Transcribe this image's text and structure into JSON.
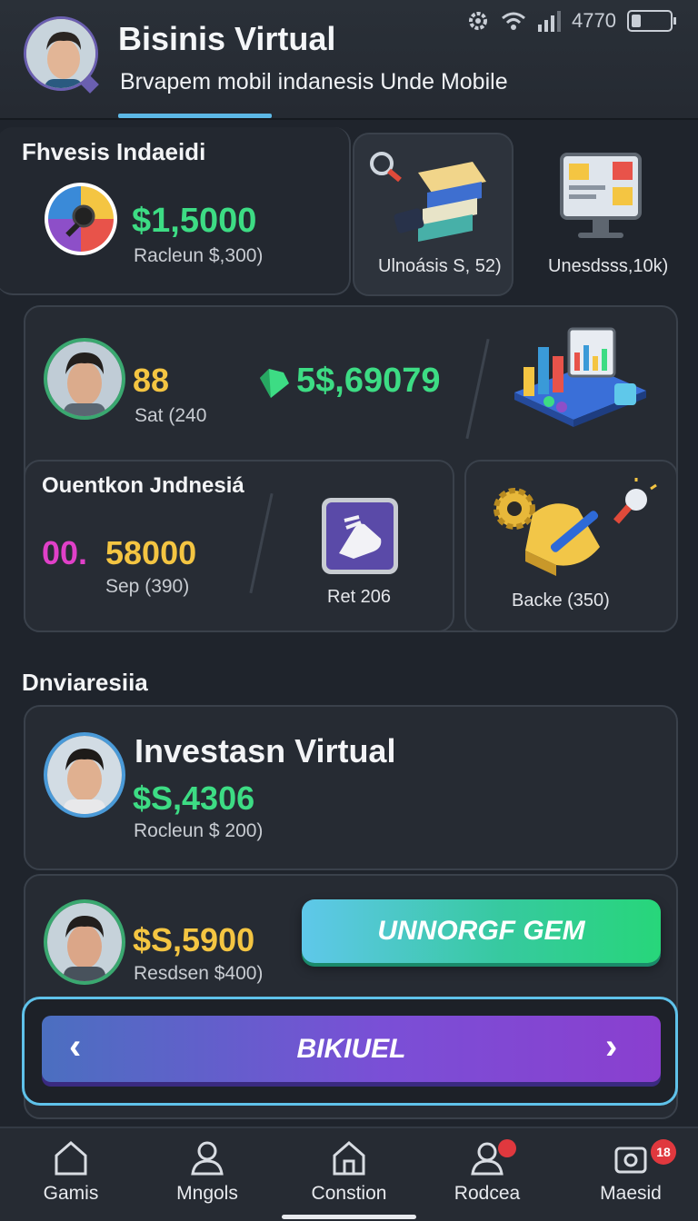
{
  "status_bar": {
    "time": "4770",
    "icons": [
      "gear-icon",
      "wifi-icon",
      "signal-icon",
      "battery-icon"
    ]
  },
  "header": {
    "title": "Bisinis Virtual",
    "subtitle": "Brvapem mobil  indanesis Unde Mobile"
  },
  "section1": {
    "heading": "Fhvesis Indaeidi",
    "main": {
      "value": "$1,5000",
      "caption": "Racleun $,300)"
    },
    "tile1": {
      "caption": "Ulnoásis S, 52)"
    },
    "tile2": {
      "caption": "Unesdsss,10k)"
    }
  },
  "stats_card": {
    "count": "88",
    "count_caption": "Sat (240",
    "gem_value": "5$,69079"
  },
  "sub_card1": {
    "title": "Ouentkon Jndnesiá",
    "prefix": "00.",
    "value": "58000",
    "caption": "Sep (390)",
    "tile_caption": "Ret 206"
  },
  "sub_card2": {
    "caption": "Backe (350)"
  },
  "section2": {
    "heading": "Dnviaresiia",
    "invest_card": {
      "title": "Investasn Virtual",
      "value": "$S,4306",
      "caption": "Rocleun $ 200)"
    },
    "card2": {
      "value": "$S,5900",
      "caption": "Resdsen $400)"
    }
  },
  "buttons": {
    "upgrade": "UNNORGF GEM",
    "nav_bar": "BIKIUEL"
  },
  "bottom_nav": {
    "items": [
      {
        "label": "Gamis",
        "icon": "home-icon"
      },
      {
        "label": "Mngols",
        "icon": "user-icon"
      },
      {
        "label": "Constion",
        "icon": "house-icon"
      },
      {
        "label": "Rodcea",
        "icon": "chat-user-icon",
        "badge": ""
      },
      {
        "label": "Maesid",
        "icon": "wallet-icon",
        "badge": "18"
      }
    ]
  },
  "colors": {
    "accent_green": "#3ddc84",
    "accent_yellow": "#f4c542",
    "accent_blue": "#5cb8e6",
    "accent_purple": "#7a4fd6"
  }
}
